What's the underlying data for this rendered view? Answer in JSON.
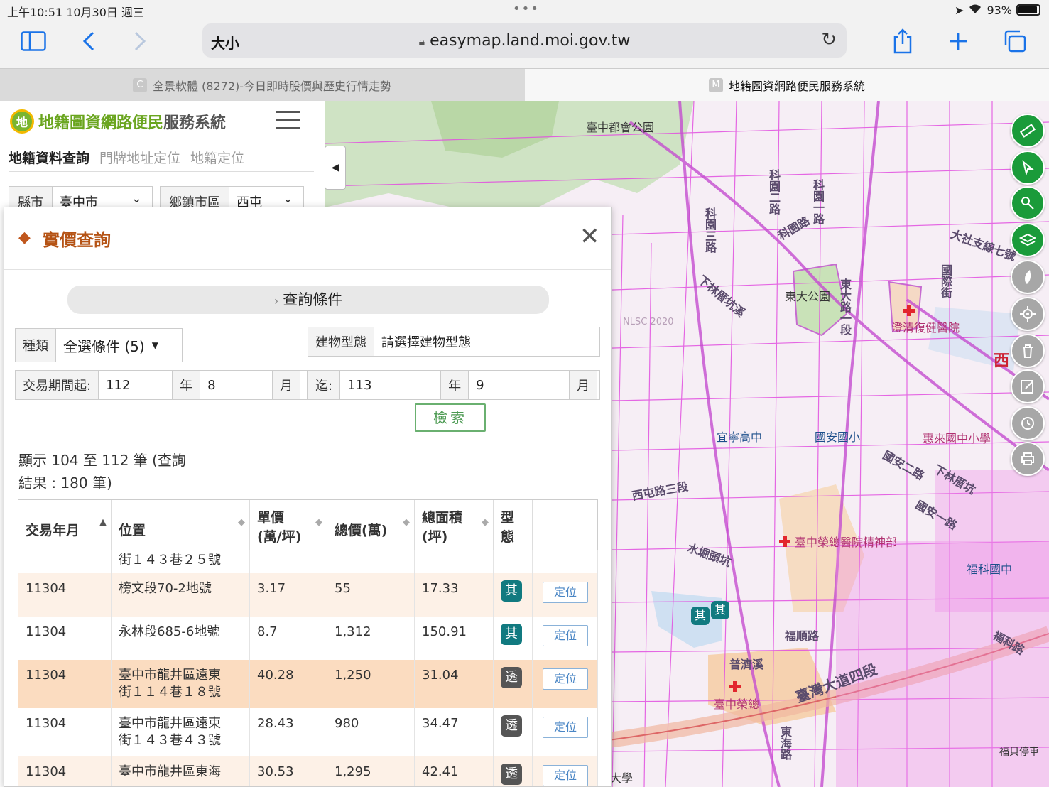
{
  "status_bar": {
    "time_date": "上午10:51   10月30日 週三",
    "battery": "93%",
    "battery_level": 0.93
  },
  "browser": {
    "reader_label": "大小",
    "url": "easymap.land.moi.gov.tw",
    "tabs": [
      {
        "favicon": "C",
        "title": "全景軟體 (8272)-今日即時股價與歷史行情走勢"
      },
      {
        "favicon": "M",
        "title": "地籍圖資網路便民服務系統"
      }
    ]
  },
  "app": {
    "logo_char": "地",
    "title_green": "地籍圖資網路便民",
    "title_dark": "服務系統",
    "subtabs": [
      "地籍資料查詢",
      "門牌地址定位",
      "地籍定位"
    ],
    "city_label": "縣市",
    "city_value": "臺中市",
    "district_label": "鄉鎮市區",
    "district_value": "西屯"
  },
  "dialog": {
    "title": "實價查詢",
    "query_conditions": "查詢條件",
    "type_label": "種類",
    "type_value": "全選條件 (5)",
    "building_label": "建物型態",
    "building_placeholder": "請選擇建物型態",
    "period_from_label": "交易期間起:",
    "from_year": "112",
    "year_unit": "年",
    "from_month": "8",
    "month_unit": "月",
    "period_to_label": "迄:",
    "to_year": "113",
    "to_month": "9",
    "search_button": "檢索",
    "result_line1": "顯示 104 至 112 筆 (查詢",
    "result_line2": "結果 : 180 筆)",
    "table": {
      "headers": [
        "交易年月",
        "位置",
        "單價\n(萬/坪)",
        "總價(萬)",
        "總面積\n(坪)",
        "型\n態",
        ""
      ],
      "partial_row_location": "街１４３巷２５號",
      "rows": [
        {
          "ym": "11304",
          "loc1": "榜文段70-2地號",
          "loc2": "",
          "unit": "3.17",
          "total": "55",
          "area": "17.33",
          "type": "其",
          "btn": "定位"
        },
        {
          "ym": "11304",
          "loc1": "永林段685-6地號",
          "loc2": "",
          "unit": "8.7",
          "total": "1,312",
          "area": "150.91",
          "type": "其",
          "btn": "定位"
        },
        {
          "ym": "11304",
          "loc1": "臺中市龍井區遠東",
          "loc2": "街１１４巷１８號",
          "unit": "40.28",
          "total": "1,250",
          "area": "31.04",
          "type": "透",
          "btn": "定位"
        },
        {
          "ym": "11304",
          "loc1": "臺中市龍井區遠東",
          "loc2": "街１４３巷４３號",
          "unit": "28.43",
          "total": "980",
          "area": "34.47",
          "type": "透",
          "btn": "定位"
        },
        {
          "ym": "11304",
          "loc1": "臺中市龍井區東海",
          "loc2": "",
          "unit": "30.53",
          "total": "1,295",
          "area": "42.41",
          "type": "透",
          "btn": "定位"
        }
      ]
    }
  },
  "map": {
    "labels": [
      "臺中都會公園",
      "科園二路",
      "科園一路",
      "科園路",
      "科園三路",
      "大社支線七號",
      "下林厝坑溪",
      "東大公園",
      "東大路一段",
      "國際街",
      "澄清復健醫院",
      "NLSC 2020",
      "宜寧高中",
      "國安國小",
      "國安二路",
      "下林厝坑",
      "國安一路",
      "西屯路三段",
      "臺中榮總醫院精神部",
      "水堀頭坑",
      "福科國中",
      "福順路",
      "普濟溪",
      "臺中榮總",
      "臺灣大道四段",
      "東海路",
      "福科路",
      "福貝停車",
      "大學",
      "西",
      "惠來國中小學"
    ],
    "markers": [
      "其",
      "其"
    ]
  },
  "tools": [
    "ruler-icon",
    "pointer-select-icon",
    "touch-select-icon",
    "layers-icon",
    "taiwan-icon",
    "gps-icon",
    "trash-icon",
    "edit-icon",
    "history-icon",
    "print-icon"
  ]
}
